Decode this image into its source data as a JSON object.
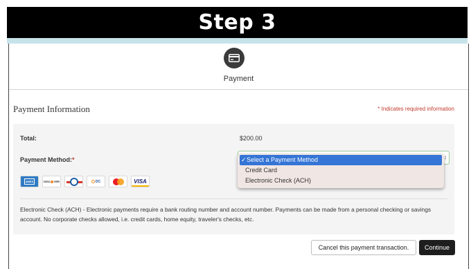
{
  "banner": {
    "title": "Step 3"
  },
  "step": {
    "icon": "credit-card-icon",
    "label": "Payment"
  },
  "section": {
    "title": "Payment Information",
    "required_note": "* Indicates required information"
  },
  "form": {
    "total_label": "Total:",
    "total_value": "$200.00",
    "method_label": "Payment Method:",
    "required_marker": "*",
    "dropdown": {
      "selected": "Select a Payment Method",
      "options": [
        "Select a Payment Method",
        "Credit Card",
        "Electronic Check (ACH)"
      ]
    },
    "accepted_cards": [
      {
        "name": "amex",
        "text": "AMERICAN EXPRESS"
      },
      {
        "name": "discover",
        "text": "DISCOVER"
      },
      {
        "name": "diners-club",
        "text": "Diners Club"
      },
      {
        "name": "dccard",
        "text": "DCcard"
      },
      {
        "name": "mastercard",
        "text": "mastercard"
      },
      {
        "name": "visa",
        "text": "VISA"
      }
    ],
    "ach_description": "Electronic Check (ACH) - Electronic payments require a bank routing number and account number. Payments can be made from a personal checking or savings account. No corporate checks allowed, i.e. credit cards, home equity, traveler's checks, etc."
  },
  "actions": {
    "cancel_label": "Cancel this payment transaction.",
    "continue_label": "Continue"
  },
  "colors": {
    "banner_bg": "#000000",
    "accent_strip": "#c6e3ea",
    "required_red": "#c0392b",
    "selected_option": "#3475d6"
  }
}
